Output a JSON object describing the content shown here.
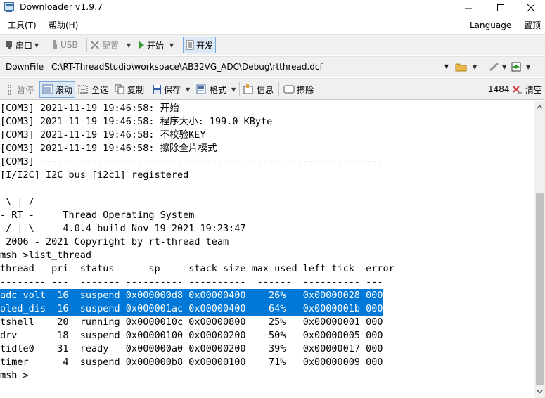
{
  "window": {
    "title": "Downloader v1.9.7"
  },
  "menu": {
    "tools": "工具(T)",
    "help": "帮助(H)",
    "language": "Language",
    "top": "置顶"
  },
  "toolbar1": {
    "serial": "串口",
    "usb": "USB",
    "config": "配置",
    "start": "开始",
    "dev": "开发"
  },
  "toolbar2": {
    "label": "DownFile",
    "path": "C:\\RT-ThreadStudio\\workspace\\AB32VG_ADC\\Debug\\rtthread.dcf"
  },
  "toolbar3": {
    "pause": "暂停",
    "scroll": "滚动",
    "select_all": "全选",
    "copy": "复制",
    "save": "保存",
    "format": "格式",
    "info": "信息",
    "erase": "擦除",
    "count": "1484",
    "clear": "清空"
  },
  "console": {
    "lines": [
      "[COM3] 2021-11-19 19:46:58: 开始",
      "[COM3] 2021-11-19 19:46:58: 程序大小: 199.0 KByte",
      "[COM3] 2021-11-19 19:46:58: 不校验KEY",
      "[COM3] 2021-11-19 19:46:58: 擦除全片模式",
      "[COM3] ------------------------------------------------------------",
      "[I/I2C] I2C bus [i2c1] registered",
      "",
      " \\ | /",
      "- RT -     Thread Operating System",
      " / | \\     4.0.4 build Nov 19 2021 19:23:47",
      " 2006 - 2021 Copyright by rt-thread team",
      "msh >list_thread",
      "thread   pri  status      sp     stack size max used left tick  error",
      "-------- ---  ------- ---------- ----------  ------  ---------- ---",
      "adc_volt  16  suspend 0x000000d8 0x00000400    26%   0x00000028 000",
      "oled_dis  16  suspend 0x000001ac 0x00000400    64%   0x0000001b 000",
      "tshell    20  running 0x0000010c 0x00000800    25%   0x00000001 000",
      "drv       18  suspend 0x00000100 0x00000200    50%   0x00000005 000",
      "tidle0    31  ready   0x000000a0 0x00000200    39%   0x00000017 000",
      "timer      4  suspend 0x000000b8 0x00000100    71%   0x00000009 000",
      "msh >"
    ],
    "selected_lines": [
      14,
      15
    ]
  },
  "colors": {
    "selection": "#0078d7",
    "toolbar_bg": "#f0f0f0"
  }
}
